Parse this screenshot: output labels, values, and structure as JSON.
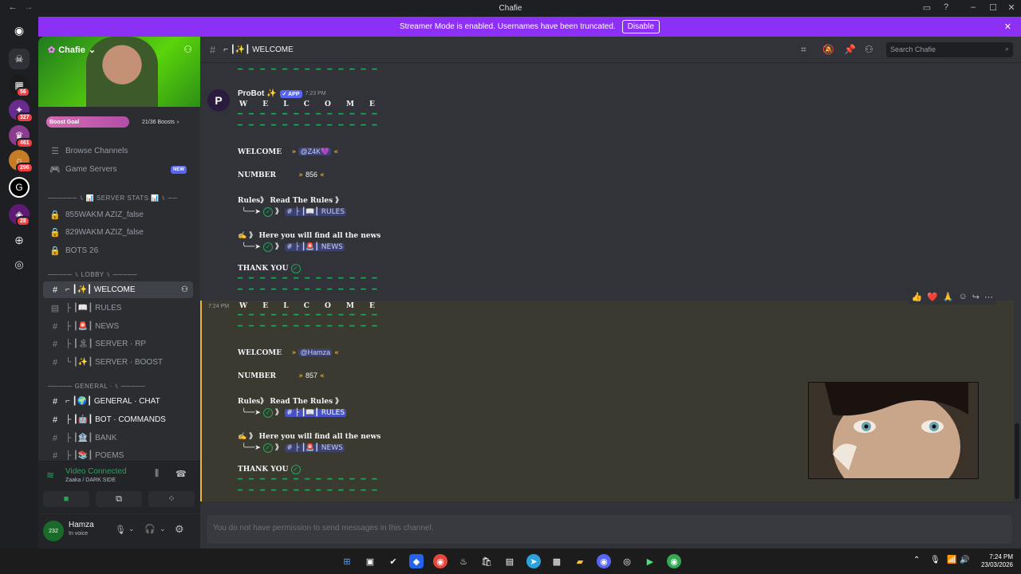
{
  "window": {
    "title": "Chafie"
  },
  "banner": {
    "text": "Streamer Mode is enabled. Usernames have been truncated.",
    "button": "Disable"
  },
  "server_rail": {
    "badges": [
      "56",
      "327",
      "461",
      "296",
      "28"
    ]
  },
  "server": {
    "name": "Chafie",
    "boost_label": "Boost Goal",
    "boost_count": "21/36 Boosts"
  },
  "sidebar": {
    "top_items": [
      {
        "label": "Browse Channels"
      },
      {
        "label": "Game Servers",
        "badge": "NEW"
      }
    ],
    "stats_category": "────── ⑊ 📊 SERVER STATS 📊 ⑊ ──",
    "stats": [
      "855WAKM AZIZ_false",
      "829WAKM AZIZ_false",
      "BOTS 26"
    ],
    "lobby_category": "───── ⑊ LOBBY ⑊ ─────",
    "lobby": [
      "⌐ ┃✨┃ WELCOME",
      "├ ┃📖┃ RULES",
      "├ ┃🚨┃ NEWS",
      "├ ┃🏝┃ SERVER · RP",
      "└ ┃✨┃ SERVER · BOOST"
    ],
    "general_category": "───── GENERAL · ⑊ ─────",
    "general": [
      "⌐ ┃🌍┃ GENERAL · CHAT",
      "├ ┃🤖┃ BOT · COMMANDS",
      "├ ┃🏦┃ BANK",
      "├ ┃📚┃ POEMS"
    ]
  },
  "voice": {
    "status": "Video Connected",
    "channel": "Zaaka / DARK SIDE"
  },
  "user": {
    "name": "Hamza",
    "status": "In voice"
  },
  "channel": {
    "name": "⌐ ┃✨┃ WELCOME",
    "search_placeholder": "Search Chafie"
  },
  "messages": {
    "author": "ProBot ✨",
    "app_tag": "✓ APP",
    "time1": "7:23 PM",
    "time2": "7:24 PM",
    "welcome_spaced": "W E L C O M E",
    "dashes": "━ ━ ━ ━ ━ ━ ━ ━ ━ ━ ━ ━ ━",
    "welcome_label": "WELCOME",
    "number_label": "NUMBER",
    "msg1": {
      "mention": "@Z4K💜",
      "number": "856"
    },
    "msg2": {
      "mention": "@Hamza",
      "number": "857"
    },
    "rules_line": "Rules》 Read The Rules 》",
    "rules_chan": "# ├ ┃📖┃ RULES",
    "news_line": "✍ 》 Here you will find all the news",
    "news_chan": "# ├ ┃🚨┃ NEWS",
    "arrow": "╰──➤",
    "thanks": "THANK YOU"
  },
  "reactions": [
    "👍",
    "❤️",
    "🙏"
  ],
  "composer": {
    "placeholder": "You do not have permission to send messages in this channel."
  },
  "clock": {
    "time": "7:24 PM",
    "date": "23/03/2026"
  }
}
